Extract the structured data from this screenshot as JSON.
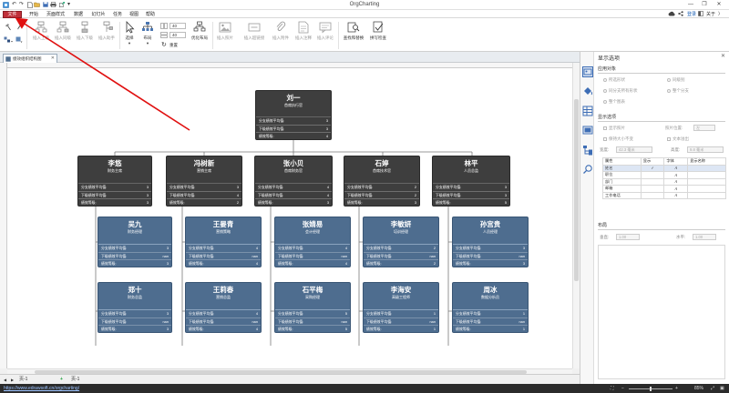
{
  "window": {
    "title": "OrgCharting"
  },
  "menu": {
    "file": "文件",
    "items": [
      "开始",
      "页面样式",
      "数据",
      "幻灯片",
      "任务",
      "视图",
      "帮助"
    ],
    "login": "登录",
    "about": "关于",
    "arrow": "〉"
  },
  "ribbon": {
    "insert_superior": "插入上级",
    "insert_colleague": "插入同级",
    "insert_subordinate": "插入下级",
    "insert_assistant": "插入助手",
    "select": "选择",
    "layout": "布局",
    "spacing_h": "40",
    "spacing_v": "40",
    "optimize_layout": "优化布局",
    "reset": "重置",
    "insert_image": "插入照片",
    "insert_hyperlink": "插入超链接",
    "insert_attachment": "插入附件",
    "insert_note": "插入注释",
    "insert_comment": "插入评论",
    "find_replace": "查找和替换",
    "spell_check": "拼写检查"
  },
  "document_tab": {
    "label": "绩效组织结构图"
  },
  "org": {
    "metric_labels": [
      "分支绩效平均值:",
      "下级绩效平均值:",
      "绩效等级:"
    ],
    "root": {
      "name": "刘一",
      "role": "首席执行官",
      "values": [
        "3",
        "3",
        "4"
      ]
    },
    "managers": [
      {
        "name": "李悠",
        "role": "财务主席",
        "values": [
          "3",
          "3",
          "3"
        ]
      },
      {
        "name": "冯树新",
        "role": "营销主席",
        "values": [
          "3",
          "4",
          "2"
        ]
      },
      {
        "name": "张小贝",
        "role": "首席财务官",
        "values": [
          "4",
          "4",
          "3"
        ]
      },
      {
        "name": "石婷",
        "role": "首席技术官",
        "values": [
          "2",
          "2",
          "3"
        ]
      },
      {
        "name": "林平",
        "role": "人员总监",
        "values": [
          "3",
          "3",
          "5"
        ]
      }
    ],
    "staff_row1": [
      {
        "name": "吴九",
        "role": "财务经理",
        "values": [
          "3",
          "nan",
          "3"
        ]
      },
      {
        "name": "王晏青",
        "role": "营销策略",
        "values": [
          "4",
          "nan",
          "4"
        ]
      },
      {
        "name": "张婧易",
        "role": "会计经理",
        "values": [
          "4",
          "nan",
          "4"
        ]
      },
      {
        "name": "李敏妍",
        "role": "培训经理",
        "values": [
          "2",
          "nan",
          "2"
        ]
      },
      {
        "name": "孙宫贵",
        "role": "人员经理",
        "values": [
          "3",
          "nan",
          "3"
        ]
      }
    ],
    "staff_row2": [
      {
        "name": "郑十",
        "role": "财务总监",
        "values": [
          "3",
          "nan",
          "3"
        ]
      },
      {
        "name": "王莉春",
        "role": "营销总监",
        "values": [
          "4",
          "nan",
          "4"
        ]
      },
      {
        "name": "石平梅",
        "role": "采购经理",
        "values": [
          "5",
          "nan",
          "5"
        ]
      },
      {
        "name": "李海安",
        "role": "高级工程师",
        "values": [
          "1",
          "nan",
          "1"
        ]
      },
      {
        "name": "周冰",
        "role": "数据分析员",
        "values": [
          "1",
          "nan",
          "1"
        ]
      }
    ]
  },
  "sheets": {
    "current": "页-1",
    "tab": "页-1",
    "add": "+"
  },
  "status": {
    "url": "https://www.edrawsoft.cn/orgcharting/",
    "zoom": "85%"
  },
  "panel": {
    "title": "显示选项",
    "apply_to": "应用对象",
    "opt_selected": "所选形状",
    "opt_same_level": "同级别",
    "opt_same_branch": "同分支所有形状",
    "opt_whole_branch": "整个分支",
    "opt_whole": "整个图表",
    "display_options": "显示选项",
    "show_photo": "显示照片",
    "photo_pos_label": "照片位置:",
    "photo_pos": "左",
    "keep_size": "保持大小不变",
    "text_wrap": "文本溢出",
    "width_label": "宽度:",
    "width_value": "42.3 毫米",
    "height_label": "高度:",
    "height_value": "9.8 毫米",
    "table_header": [
      "属性",
      "显示",
      "字体",
      "显示名称"
    ],
    "fields": [
      "姓名",
      "职位",
      "部门",
      "邮箱",
      "工作电话"
    ],
    "layout": "布局",
    "vertical_label": "垂直:",
    "vertical_value": "1.00",
    "horizontal_label": "水平:",
    "horizontal_value": "1.00",
    "checkmark": "✓",
    "font_glyph": "A"
  }
}
